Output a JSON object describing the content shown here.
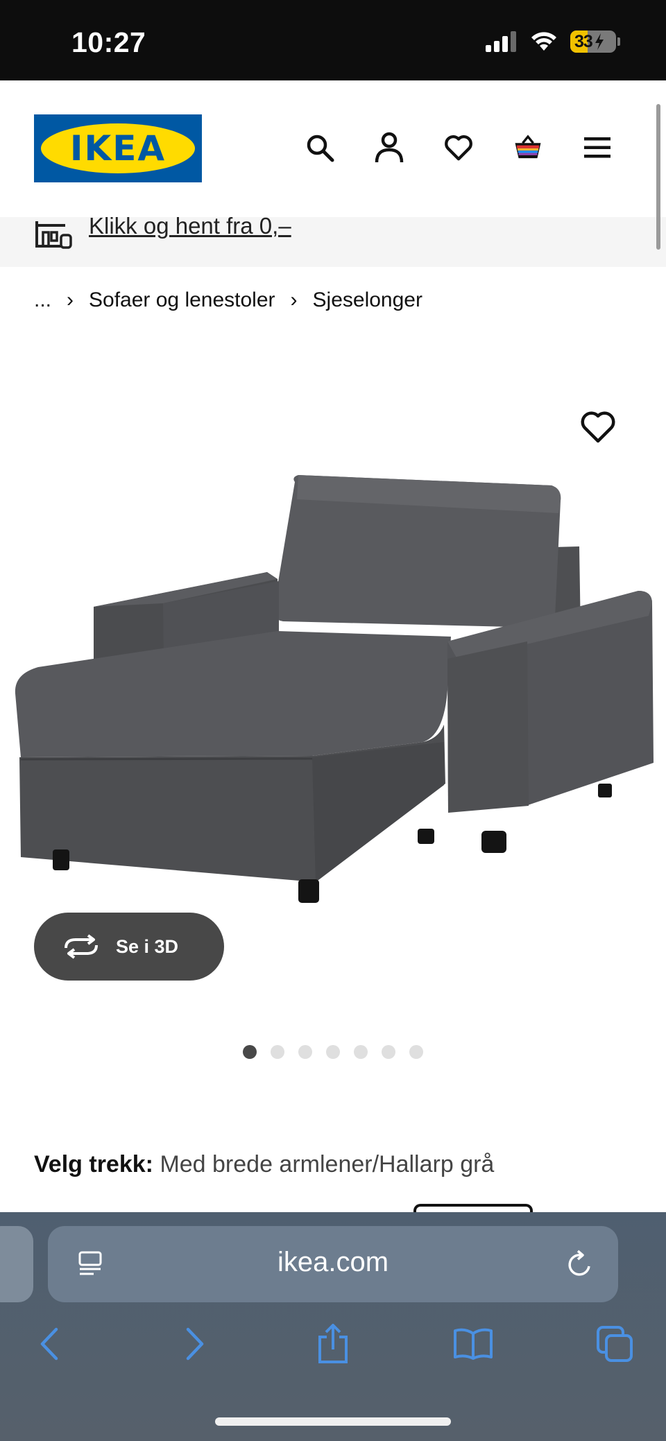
{
  "status_bar": {
    "time": "10:27",
    "battery": "33"
  },
  "header": {
    "logo": "IKEA"
  },
  "promo": {
    "text": "Klikk og hent fra 0,–"
  },
  "breadcrumb": {
    "ellipsis": "...",
    "items": [
      "Sofaer og lenestoler",
      "Sjeselonger"
    ],
    "separator": "›"
  },
  "product": {
    "view_3d_label": "Se i 3D",
    "image_count": 7,
    "active_image": 1,
    "cover_label": "Velg trekk:",
    "cover_value": "Med brede armlener/Hallarp grå"
  },
  "browser": {
    "url": "ikea.com"
  },
  "colors": {
    "ikea_blue": "#0058a3",
    "ikea_yellow": "#ffdb00",
    "sofa_grey": "#5c5d60",
    "button_dark": "#484848"
  },
  "icons": [
    "search-icon",
    "account-icon",
    "heart-icon",
    "cart-icon",
    "menu-icon",
    "store-icon",
    "rotate-icon",
    "reader-icon",
    "reload-icon",
    "back-icon",
    "forward-icon",
    "share-icon",
    "bookmarks-icon",
    "tabs-icon"
  ]
}
